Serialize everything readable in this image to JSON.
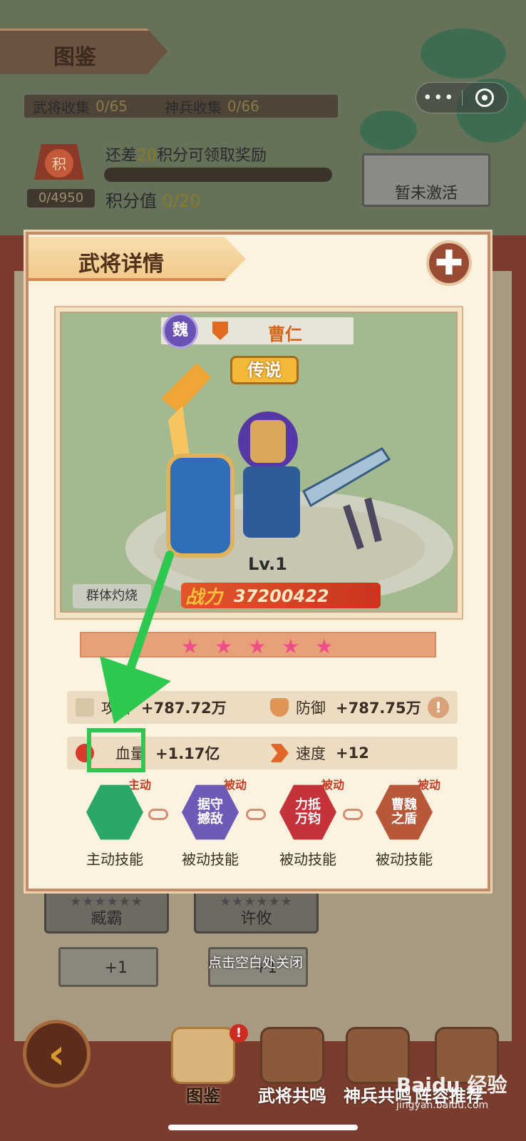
{
  "page": {
    "title": "图鉴",
    "collection": {
      "generals_label": "武将收集",
      "generals_value": "0/65",
      "weapons_label": "神兵收集",
      "weapons_value": "0/66"
    },
    "reward": {
      "prefix": "还差",
      "points": "20",
      "suffix": "积分可领取奖励",
      "badge_char": "积",
      "score_count": "0/4950",
      "points_label": "积分值",
      "points_value": "0/20"
    },
    "inactive_label": "暂未激活",
    "bg_cards": [
      {
        "name": "臧霸",
        "stars": "★★★★★★"
      },
      {
        "name": "许攸",
        "stars": "★★★★★★"
      }
    ],
    "bg_plus": [
      "+1",
      "+1"
    ],
    "close_hint": "点击空白处关闭"
  },
  "mini_program": {
    "more_icon": "more-dots-icon",
    "close_icon": "target-icon"
  },
  "modal": {
    "title": "武将详情",
    "close_icon": "close-icon",
    "hero": {
      "faction": "魏",
      "name": "曹仁",
      "rarity": "传说",
      "level": "Lv.1",
      "power_label": "战力",
      "power_value": "37200422",
      "skill_tag": "群体灼烧",
      "stars": 5,
      "star_glyphs": "★★★★★"
    },
    "stats": {
      "attack_label": "攻击",
      "attack_value": "+787.72万",
      "defense_label": "防御",
      "defense_value": "+787.75万",
      "hp_label": "血量",
      "hp_value": "+1.17亿",
      "speed_label": "速度",
      "speed_value": "+12",
      "info_icon": "!"
    },
    "skills": [
      {
        "badge": "主动",
        "icon_text": "",
        "label": "主动技能",
        "color": "#2aa86a"
      },
      {
        "badge": "被动",
        "icon_text": "据守撼敌",
        "label": "被动技能",
        "color": "#6e5bb8"
      },
      {
        "badge": "被动",
        "icon_text": "力抵万钧",
        "label": "被动技能",
        "color": "#c5323a"
      },
      {
        "badge": "被动",
        "icon_text": "曹魏之盾",
        "label": "被动技能",
        "color": "#b8583a"
      }
    ]
  },
  "bottom_nav": {
    "back_glyph": "‹",
    "items": [
      {
        "label": "图鉴",
        "active": true,
        "notify": "!"
      },
      {
        "label": "武将共鸣"
      },
      {
        "label": "神兵共鸣"
      },
      {
        "label": "阵容推荐"
      }
    ]
  },
  "watermark": {
    "brand": "Baidu 经验",
    "site": "jingyan.baidu.com"
  },
  "colors": {
    "highlight": "#2ec84f",
    "accent_orange": "#d3651c",
    "modal_border": "#c78a67"
  }
}
